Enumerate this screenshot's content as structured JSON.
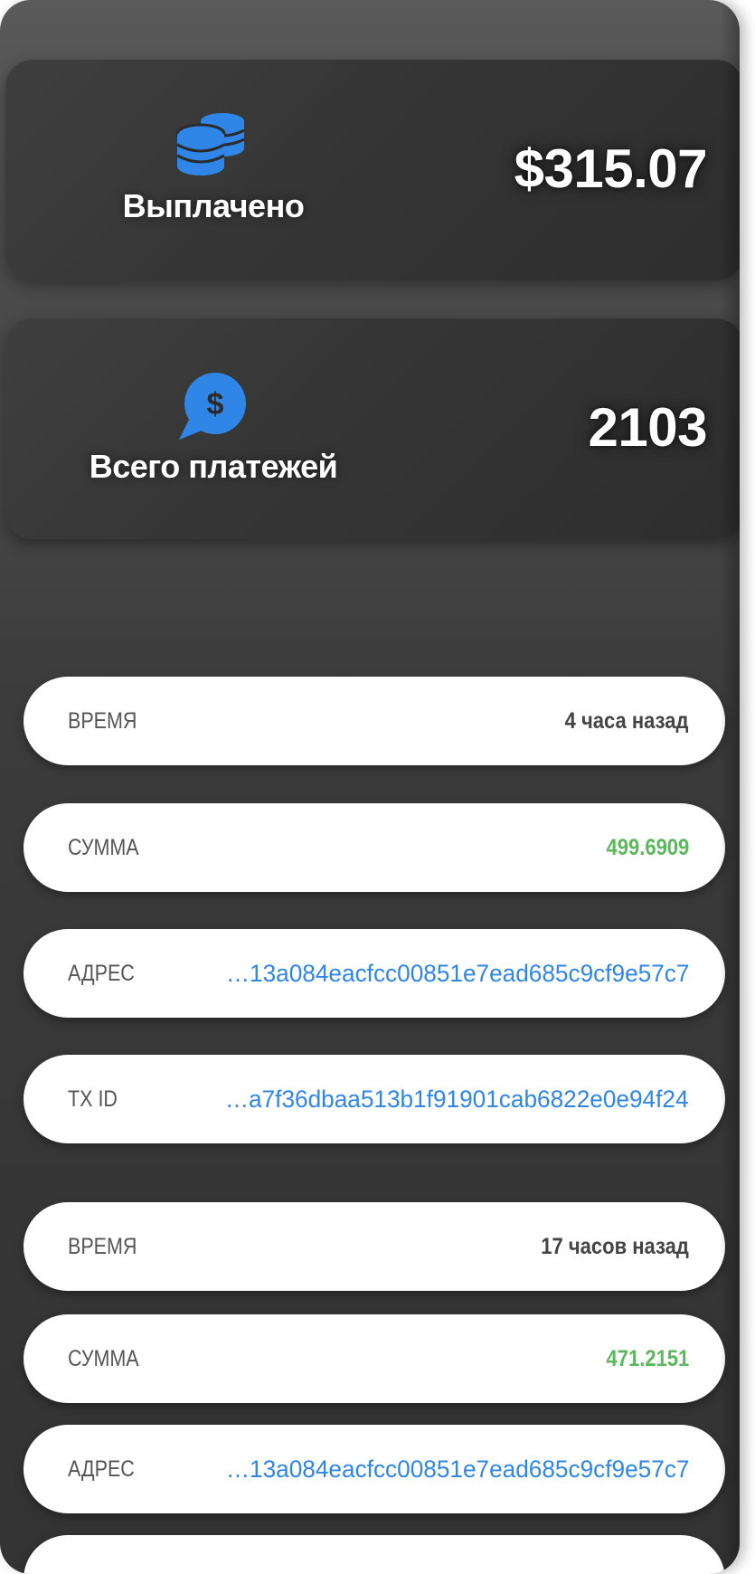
{
  "stats": {
    "paid": {
      "label": "Выплачено",
      "value": "$315.07",
      "icon": "coins-stack-icon"
    },
    "total": {
      "label": "Всего платежей",
      "value": "2103",
      "icon": "dollar-chat-bubble-icon"
    }
  },
  "colors": {
    "icon_blue": "#2f86e6",
    "amount_green": "#5cb85c",
    "link_blue": "#2f86e6"
  },
  "payments": [
    {
      "time_label": "ВРЕМЯ",
      "time": "4 часа назад",
      "amount_label": "СУММА",
      "amount": "499.6909",
      "address_label": "АДРЕС",
      "address": "…13a084eacfcc00851e7ead685c9cf9e57c7",
      "txid_label": "TX ID",
      "txid": "…a7f36dbaa513b1f91901cab6822e0e94f24"
    },
    {
      "time_label": "ВРЕМЯ",
      "time": "17 часов назад",
      "amount_label": "СУММА",
      "amount": "471.2151",
      "address_label": "АДРЕС",
      "address": "…13a084eacfcc00851e7ead685c9cf9e57c7"
    }
  ]
}
